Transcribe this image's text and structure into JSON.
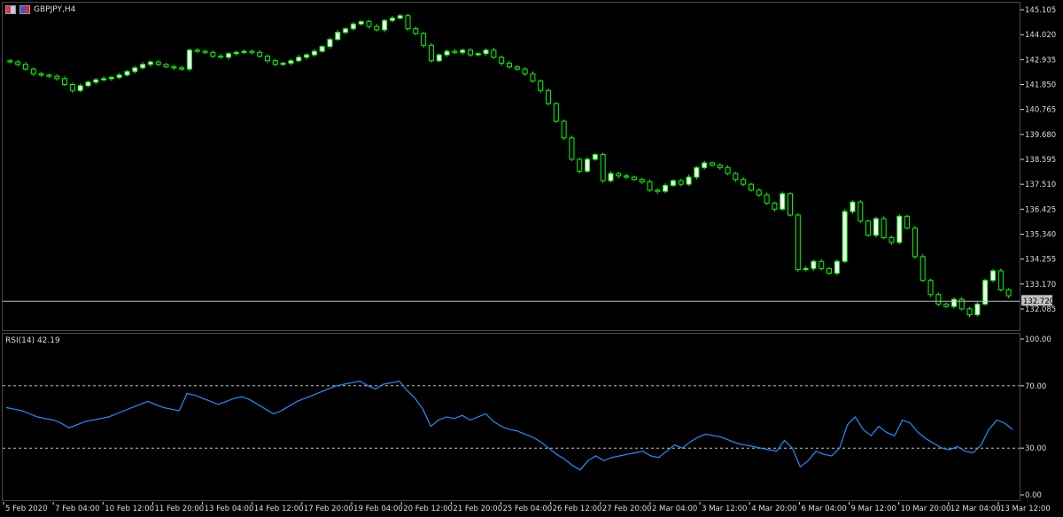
{
  "symbol": {
    "title": "GBPJPY,H4"
  },
  "rsi": {
    "label": "RSI(14) 42.19",
    "levels": [
      30,
      70
    ],
    "ylim": [
      0,
      100
    ],
    "ticks": [
      "100.00",
      "70.00",
      "30.00",
      "0.00"
    ]
  },
  "price_axis": {
    "ticks": [
      "145.105",
      "144.020",
      "142.935",
      "141.850",
      "140.765",
      "139.680",
      "138.595",
      "137.510",
      "136.425",
      "135.340",
      "134.255",
      "133.170",
      "132.085"
    ],
    "current_price_label": "132.720",
    "current_price": 132.72
  },
  "time_axis": {
    "labels": [
      "5 Feb 2020",
      "7 Feb 04:00",
      "10 Feb 12:00",
      "11 Feb 20:00",
      "13 Feb 04:00",
      "14 Feb 12:00",
      "17 Feb 20:00",
      "19 Feb 04:00",
      "20 Feb 12:00",
      "21 Feb 20:00",
      "25 Feb 04:00",
      "26 Feb 12:00",
      "27 Feb 20:00",
      "2 Mar 04:00",
      "3 Mar 12:00",
      "4 Mar 20:00",
      "6 Mar 04:00",
      "9 Mar 12:00",
      "10 Mar 20:00",
      "12 Mar 04:00",
      "13 Mar 12:00"
    ]
  },
  "colors": {
    "background": "#000000",
    "bull_fill": "#ffffff",
    "bull_border": "#00ff00",
    "bear_fill": "#000000",
    "bear_border": "#00ff00",
    "wick": "#00ff00",
    "rsi_line": "#1e90ff",
    "grid_dashed": "#c0c0c0",
    "price_line": "#c0c0c0",
    "axis_text": "#dcdcdc",
    "price_badge_bg": "#c0c0c0",
    "price_badge_text": "#000000"
  },
  "chart_data": [
    {
      "type": "candlestick",
      "title": "GBPJPY,H4",
      "ylim": [
        131.5,
        145.3
      ],
      "values_close": [
        142.8,
        142.7,
        142.5,
        142.3,
        142.25,
        142.2,
        142.1,
        141.85,
        141.6,
        141.8,
        141.95,
        142.05,
        142.1,
        142.15,
        142.25,
        142.4,
        142.55,
        142.7,
        142.8,
        142.7,
        142.6,
        142.55,
        142.5,
        143.3,
        143.25,
        143.2,
        143.05,
        143.0,
        143.15,
        143.2,
        143.25,
        143.2,
        143.05,
        142.85,
        142.7,
        142.75,
        142.85,
        143.0,
        143.1,
        143.25,
        143.45,
        143.75,
        144.05,
        144.2,
        144.4,
        144.5,
        144.3,
        144.15,
        144.55,
        144.65,
        144.75,
        144.2,
        144.0,
        143.5,
        142.85,
        143.1,
        143.25,
        143.2,
        143.3,
        143.1,
        143.15,
        143.3,
        143.0,
        142.75,
        142.6,
        142.5,
        142.3,
        142.0,
        141.6,
        141.05,
        140.3,
        139.6,
        138.7,
        138.2,
        138.7,
        138.9,
        137.8,
        138.1,
        138.0,
        137.95,
        137.85,
        137.75,
        137.4,
        137.35,
        137.6,
        137.8,
        137.65,
        137.95,
        138.35,
        138.55,
        138.45,
        138.35,
        138.1,
        137.85,
        137.65,
        137.4,
        137.2,
        136.85,
        136.6,
        137.25,
        136.35,
        134.05,
        134.1,
        134.4,
        134.1,
        133.9,
        134.4,
        136.5,
        136.9,
        136.1,
        135.5,
        136.2,
        135.4,
        135.2,
        136.3,
        135.8,
        134.6,
        133.6,
        133.0,
        132.6,
        132.5,
        132.8,
        132.4,
        132.15,
        132.6,
        133.6,
        134.0,
        133.2,
        132.95
      ],
      "rsi_values": [
        56,
        55,
        54,
        52,
        50,
        49,
        48,
        46,
        43,
        45,
        47,
        48,
        49,
        50,
        52,
        54,
        56,
        58,
        60,
        58,
        56,
        55,
        54,
        65,
        64,
        62,
        60,
        58,
        60,
        62,
        63,
        61,
        58,
        55,
        52,
        54,
        57,
        60,
        62,
        64,
        66,
        68,
        70,
        71,
        72,
        73,
        70,
        68,
        71,
        72,
        73,
        67,
        62,
        55,
        44,
        48,
        50,
        49,
        51,
        48,
        50,
        52,
        47,
        44,
        42,
        41,
        39,
        37,
        34,
        30,
        26,
        23,
        19,
        16,
        22,
        25,
        22,
        24,
        25,
        26,
        27,
        28,
        25,
        24,
        28,
        32,
        30,
        34,
        37,
        39,
        38,
        37,
        35,
        33,
        32,
        31,
        30,
        29,
        28,
        35,
        30,
        18,
        22,
        28,
        26,
        25,
        30,
        45,
        50,
        42,
        38,
        44,
        40,
        38,
        48,
        46,
        40,
        36,
        33,
        30,
        29,
        31,
        28,
        27,
        32,
        42,
        48,
        46,
        42
      ],
      "notes": "GBP/JPY H4 candlestick chart with RSI(14) indicator"
    }
  ]
}
